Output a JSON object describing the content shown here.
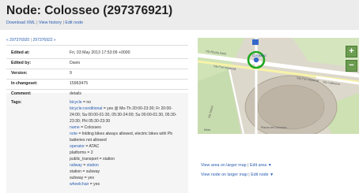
{
  "header": {
    "title": "Node: Colosseo (297376921)",
    "links": [
      "Download XML",
      "View history",
      "Edit node"
    ]
  },
  "nav": {
    "prev": "« 297376920",
    "next": "297376922 »"
  },
  "details": [
    {
      "label": "Edited at:",
      "value": "Fri, 03 May 2013 17:53:09 +0000",
      "link": false
    },
    {
      "label": "Edited by:",
      "value": "Davio",
      "link": true
    },
    {
      "label": "Version:",
      "value": "9",
      "link": false
    },
    {
      "label": "In changeset:",
      "value": "15963475",
      "link": true
    },
    {
      "label": "Comment:",
      "value": "details",
      "link": false
    }
  ],
  "tags": {
    "label": "Tags:",
    "lines": [
      {
        "key": "bicycle",
        "rest": " = no"
      },
      {
        "key": "bicycle:conditional",
        "rest": " = yes @ Mo-Th 20:00-23:30; Fr 20:00-"
      },
      {
        "key": "",
        "rest": "24:00; Sa 00:00-01:30, 05:30-24:00; Su 00:00-01:30, 05:30-"
      },
      {
        "key": "",
        "rest": "23:30; PH 05:30-23:30"
      },
      {
        "key": "name",
        "rest": " = Colosseo"
      },
      {
        "key": "note",
        "rest": " = folding bikes always allowed, electric bikes with Pb"
      },
      {
        "key": "",
        "rest": "batteries not allowed"
      },
      {
        "key": "operator",
        "rest": " = ATAC"
      },
      {
        "key": "",
        "rest": "platforms = 2"
      },
      {
        "key": "",
        "rest": "public_transport = station"
      },
      {
        "key": "railway",
        "rest": " = ",
        "val": "station"
      },
      {
        "key": "",
        "rest": "station = subway"
      },
      {
        "key": "",
        "rest": "subway = yes"
      },
      {
        "key": "wheelchair",
        "rest": " = yes"
      }
    ]
  },
  "map": {
    "labels": {
      "street1": "Via Nicola Salvi",
      "street2": "Via Fori Imperiali",
      "street3": "Via Fori Imperiali",
      "street4": "Via Labicana",
      "colosseo": "Colosseo",
      "via_sacra": "Via Sacra",
      "piazza": "Piazza del Colosseo",
      "meta": "Meta"
    },
    "zoom_in": "+",
    "zoom_out": "−"
  },
  "map_links": {
    "area": {
      "view": "View area on larger map",
      "edit": "Edit area"
    },
    "node": {
      "view": "View node on larger map",
      "edit": "Edit node"
    },
    "arrow": "▼"
  },
  "colors": {
    "link": "#2a5db0",
    "header_bg": "#ececec",
    "map_accent": "#00a000"
  }
}
